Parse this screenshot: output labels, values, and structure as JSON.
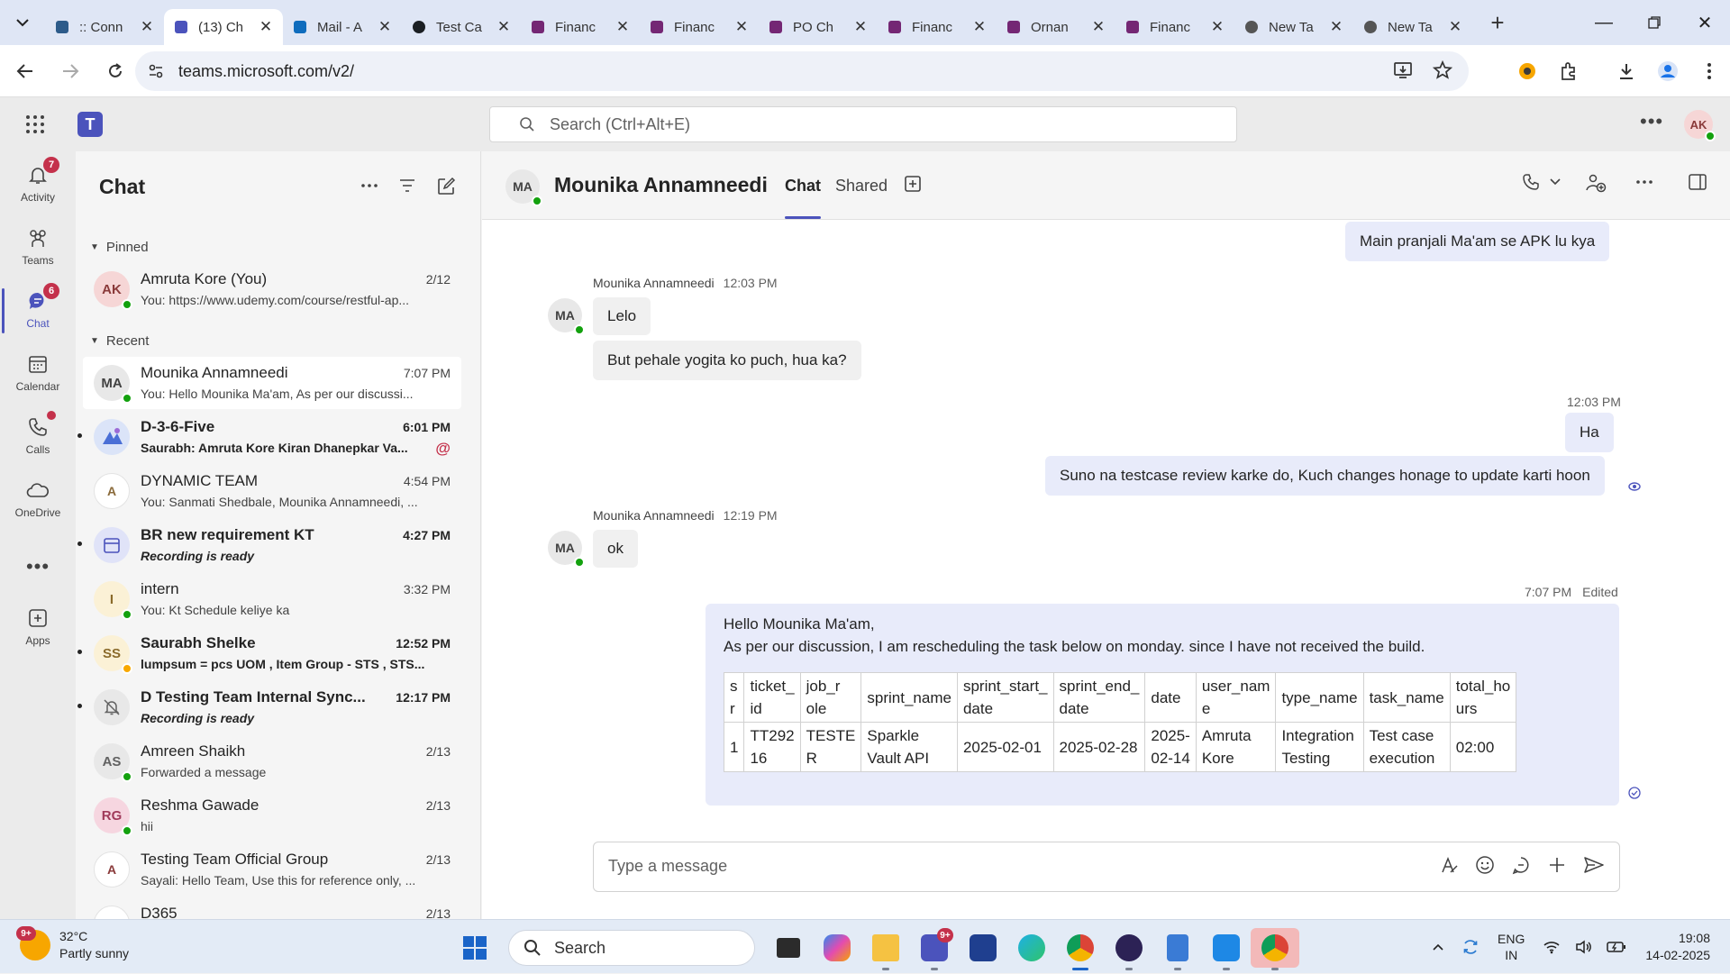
{
  "browser": {
    "tabs": [
      {
        "title": ":: Conn",
        "icon": "site-icon",
        "color": "#2d5b8a"
      },
      {
        "title": "(13) Ch",
        "icon": "teams-icon",
        "color": "#4b53bc",
        "active": true
      },
      {
        "title": "Mail - A",
        "icon": "outlook-icon",
        "color": "#0f6cbd"
      },
      {
        "title": "Test Ca",
        "icon": "github-icon",
        "color": "#1b1f23"
      },
      {
        "title": "Financ",
        "icon": "powerapps-icon",
        "color": "#742774"
      },
      {
        "title": "Financ",
        "icon": "powerapps-icon",
        "color": "#742774"
      },
      {
        "title": "PO Ch",
        "icon": "powerapps-icon",
        "color": "#742774"
      },
      {
        "title": "Financ",
        "icon": "powerapps-icon",
        "color": "#742774"
      },
      {
        "title": "Ornan",
        "icon": "powerapps-icon",
        "color": "#742774"
      },
      {
        "title": "Financ",
        "icon": "powerapps-icon",
        "color": "#742774"
      },
      {
        "title": "New Ta",
        "icon": "chrome-icon",
        "color": "#555555"
      },
      {
        "title": "New Ta",
        "icon": "chrome-icon",
        "color": "#555555"
      }
    ],
    "url": "teams.microsoft.com/v2/"
  },
  "teams": {
    "search_placeholder": "Search (Ctrl+Alt+E)",
    "user_initials": "AK",
    "rail": [
      {
        "label": "Activity",
        "badge": "7"
      },
      {
        "label": "Teams",
        "badge": ""
      },
      {
        "label": "Chat",
        "badge": "6"
      },
      {
        "label": "Calendar",
        "badge": ""
      },
      {
        "label": "Calls",
        "badge": ""
      },
      {
        "label": "OneDrive",
        "badge": ""
      },
      {
        "label": "Apps",
        "badge": ""
      }
    ]
  },
  "chatlist": {
    "title": "Chat",
    "pinned_label": "Pinned",
    "recent_label": "Recent",
    "pinned": [
      {
        "name": "Amruta Kore (You)",
        "time": "2/12",
        "preview": "You: https://www.udemy.com/course/restful-ap...",
        "initials": "AK"
      }
    ],
    "recent": [
      {
        "name": "Mounika Annamneedi",
        "time": "7:07 PM",
        "preview": "You: Hello Mounika Ma'am, As per our discussi...",
        "initials": "MA"
      },
      {
        "name": "D-3-6-Five",
        "time": "6:01 PM",
        "preview": "Saurabh: Amruta Kore Kiran Dhanepkar Va...",
        "initials": ""
      },
      {
        "name": "DYNAMIC TEAM",
        "time": "4:54 PM",
        "preview": "You: Sanmati Shedbale, Mounika Annamneedi, ...",
        "initials": "A"
      },
      {
        "name": "BR new requirement KT",
        "time": "4:27 PM",
        "preview": "Recording is ready",
        "initials": ""
      },
      {
        "name": "intern",
        "time": "3:32 PM",
        "preview": "You: Kt Schedule keliye ka",
        "initials": "I"
      },
      {
        "name": "Saurabh Shelke",
        "time": "12:52 PM",
        "preview": "lumpsum = pcs UOM , Item Group - STS , STS...",
        "initials": "SS"
      },
      {
        "name": "D Testing Team Internal Sync...",
        "time": "12:17 PM",
        "preview": "Recording is ready",
        "initials": ""
      },
      {
        "name": "Amreen Shaikh",
        "time": "2/13",
        "preview": "Forwarded a message",
        "initials": "AS"
      },
      {
        "name": "Reshma Gawade",
        "time": "2/13",
        "preview": "hii",
        "initials": "RG"
      },
      {
        "name": "Testing Team Official Group",
        "time": "2/13",
        "preview": "Sayali: Hello Team, Use this for reference only, ...",
        "initials": "A"
      },
      {
        "name": "D365",
        "time": "2/13",
        "preview": "",
        "initials": "A"
      }
    ]
  },
  "conversation": {
    "name": "Mounika Annamneedi",
    "initials": "MA",
    "tabs": [
      "Chat",
      "Shared"
    ],
    "messages": {
      "out1": "Main pranjali Ma'am se APK lu kya",
      "in_meta_1": {
        "sender": "Mounika Annamneedi",
        "time": "12:03 PM"
      },
      "in1": "Lelo",
      "in2": "But pehale yogita ko puch, hua ka?",
      "out_meta_2": "12:03 PM",
      "out2": "Ha",
      "out3": "Suno na testcase review karke do, Kuch changes honage to update karti hoon",
      "in_meta_2": {
        "sender": "Mounika Annamneedi",
        "time": "12:19 PM"
      },
      "in3": "ok",
      "out_meta_3": {
        "time": "7:07 PM",
        "edited": "Edited"
      },
      "big_line1": "Hello Mounika Ma'am,",
      "big_line2": "As per our discussion, I am rescheduling the task below on monday. since I have not received the build."
    },
    "table": {
      "headers": [
        "s\nr",
        "ticket_\nid",
        "job_r\nole",
        "sprint_name",
        "sprint_start_\ndate",
        "sprint_end_\ndate",
        "date",
        "user_nam\ne",
        "type_name",
        "task_name",
        "total_ho\nurs"
      ],
      "row": [
        "1",
        "TT292\n16",
        "TESTE\nR",
        "Sparkle\nVault API",
        "2025-02-01",
        "2025-02-28",
        "2025-\n02-14",
        "Amruta\nKore",
        "Integration\nTesting",
        "Test case\nexecution",
        "02:00"
      ]
    },
    "compose_placeholder": "Type a message"
  },
  "taskbar": {
    "weather_temp": "32°C",
    "weather_desc": "Partly sunny",
    "weather_badge": "9+",
    "search_label": "Search",
    "teams_badge": "9+",
    "lang1": "ENG",
    "lang2": "IN",
    "time": "19:08",
    "date": "14-02-2025"
  },
  "colors": {
    "accent": "#4b53bc",
    "badge": "#c4314b",
    "presence": "#13a10e",
    "bubble_out": "#e8ebfa"
  }
}
